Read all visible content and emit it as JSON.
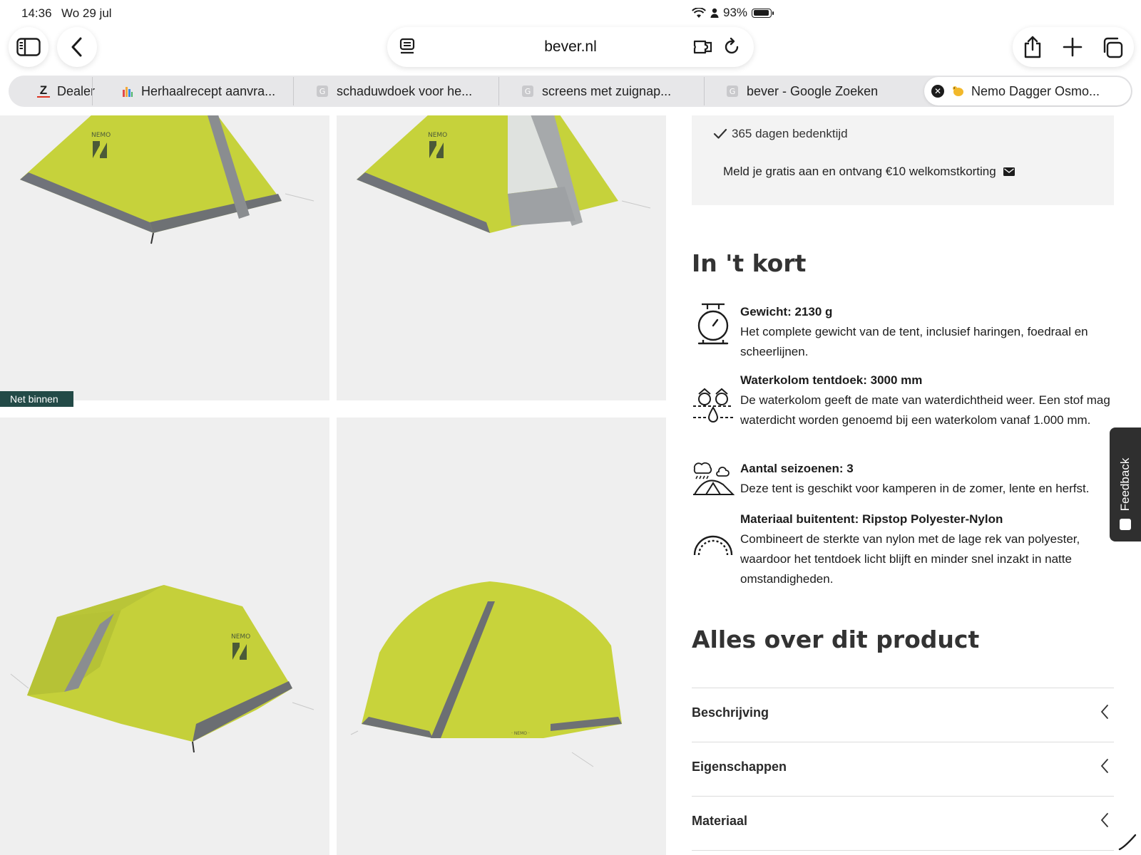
{
  "status_bar": {
    "time": "14:36",
    "date": "Wo 29 jul",
    "battery": "93%"
  },
  "browser": {
    "url": "bever.nl",
    "tabs": [
      {
        "label": "Dealer",
        "favicon": "z-icon"
      },
      {
        "label": "Herhaalrecept aanvra...",
        "favicon": "chart-icon"
      },
      {
        "label": "schaduwdoek voor he...",
        "favicon": "google-icon"
      },
      {
        "label": "screens met zuignap...",
        "favicon": "google-icon"
      },
      {
        "label": "bever - Google Zoeken",
        "favicon": "google-icon"
      },
      {
        "label": "Nemo Dagger Osmo...",
        "favicon": "bever-icon",
        "active": true
      }
    ]
  },
  "gallery": {
    "badge": "Net binnen",
    "brand_logo": "NEMO"
  },
  "benefits": {
    "days": "365 dagen bedenktijd",
    "signup": "Meld je gratis aan en ontvang €10 welkomstkorting"
  },
  "summary": {
    "title": "In 't kort",
    "features": [
      {
        "icon": "scale-icon",
        "title": "Gewicht: 2130 g",
        "text": "Het complete gewicht van de tent, inclusief haringen, foedraal en scheerlijnen."
      },
      {
        "icon": "water-column-icon",
        "title": "Waterkolom tentdoek: 3000 mm",
        "text": "De waterkolom geeft de mate van waterdichtheid weer. Een stof mag waterdicht worden genoemd bij een waterkolom vanaf 1.000 mm."
      },
      {
        "icon": "seasons-icon",
        "title": "Aantal seizoenen: 3",
        "text": "Deze tent is geschikt voor kamperen in de zomer, lente en herfst."
      },
      {
        "icon": "fabric-arc-icon",
        "title": "Materiaal buitentent: Ripstop Polyester-Nylon",
        "text": "Combineert de sterkte van nylon met de lage rek van polyester, waardoor het tentdoek licht blijft en minder snel inzakt in natte omstandigheden."
      }
    ]
  },
  "about": {
    "title": "Alles over dit product",
    "sections": [
      "Beschrijving",
      "Eigenschappen",
      "Materiaal"
    ]
  },
  "feedback": {
    "label": "Feedback"
  },
  "colors": {
    "tent_yellow": "#c9d43a",
    "tent_grey": "#6c6f72",
    "badge_green": "#234a47",
    "tile_bg": "#efefef"
  }
}
